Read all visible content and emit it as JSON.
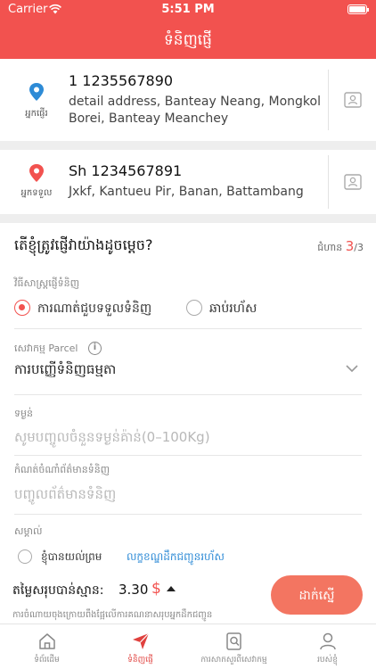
{
  "status_bar": {
    "carrier": "Carrier",
    "time": "5:51 PM"
  },
  "header": {
    "title": "ទំនិញផ្ញើ"
  },
  "sender": {
    "role": "អ្នកផ្ញើរ",
    "name_phone": "1 1235567890",
    "address_line1": "detail address, Banteay Neang, Mongkol",
    "address_line2": "Borei, Banteay Meanchey",
    "pin_color": "#2e8bd6"
  },
  "receiver": {
    "role": "អ្នកទទួល",
    "name_phone": "Sh 1234567891",
    "address": "Jxkf, Kantueu Pir, Banan, Battambang",
    "pin_color": "#f2524f"
  },
  "question": {
    "text": "តើខ្ញុំត្រូវផ្ញើវាយ៉ាងដូចម្តេច?",
    "step_label": "ជំហាន",
    "step_current": "3",
    "step_total": "/3"
  },
  "method": {
    "label": "វិធីសាស្ត្រផ្ញើទំនិញ",
    "options": [
      {
        "label": "ការណាត់ជួបទទួលទំនិញ",
        "selected": true
      },
      {
        "label": "ឆាប់រហ័ស",
        "selected": false
      }
    ]
  },
  "parcel": {
    "label": "សេវាកម្ម Parcel",
    "value": "ការបញ្ញើទំនិញធម្មតា"
  },
  "weight": {
    "label": "ទម្ងន់",
    "placeholder": "សូមបញ្ចូលចំនួនទម្ងន់គ៉ាន់(0–100Kg)"
  },
  "item_info": {
    "label": "កំណត់ចំណាំព័ត៌មានទំនិញ",
    "placeholder": "បញ្ចូលព័ត៌មានទំនិញ"
  },
  "remark": {
    "label": "សម្គាល់"
  },
  "agreement": {
    "text": "ខ្ញុំបានយល់ព្រម",
    "link": "លក្ខខណ្ឌដឹកជញ្ជូនរហ័ស"
  },
  "total": {
    "label": "តម្លៃសរុបបាន់ស្មាន:",
    "value": "3.30",
    "currency": "$",
    "note": "ការចំណាយចុងក្រោយពឹងផ្អែលើការគណនាសរុបអ្នកដឹកជញ្ជូន"
  },
  "submit_label": "ដាក់ស្នើ",
  "tabs": [
    {
      "label": "ទំព័រដើម",
      "icon": "home-icon",
      "active": false
    },
    {
      "label": "ទំនិញផ្ញើ",
      "icon": "send-icon",
      "active": true
    },
    {
      "label": "ការសាកសួរពីសេវាកម្ម",
      "icon": "search-doc-icon",
      "active": false
    },
    {
      "label": "របស់ខ្ញុំ",
      "icon": "user-icon",
      "active": false
    }
  ],
  "colors": {
    "accent": "#f2524f",
    "submit": "#f37561",
    "link": "#2e8bd6"
  }
}
